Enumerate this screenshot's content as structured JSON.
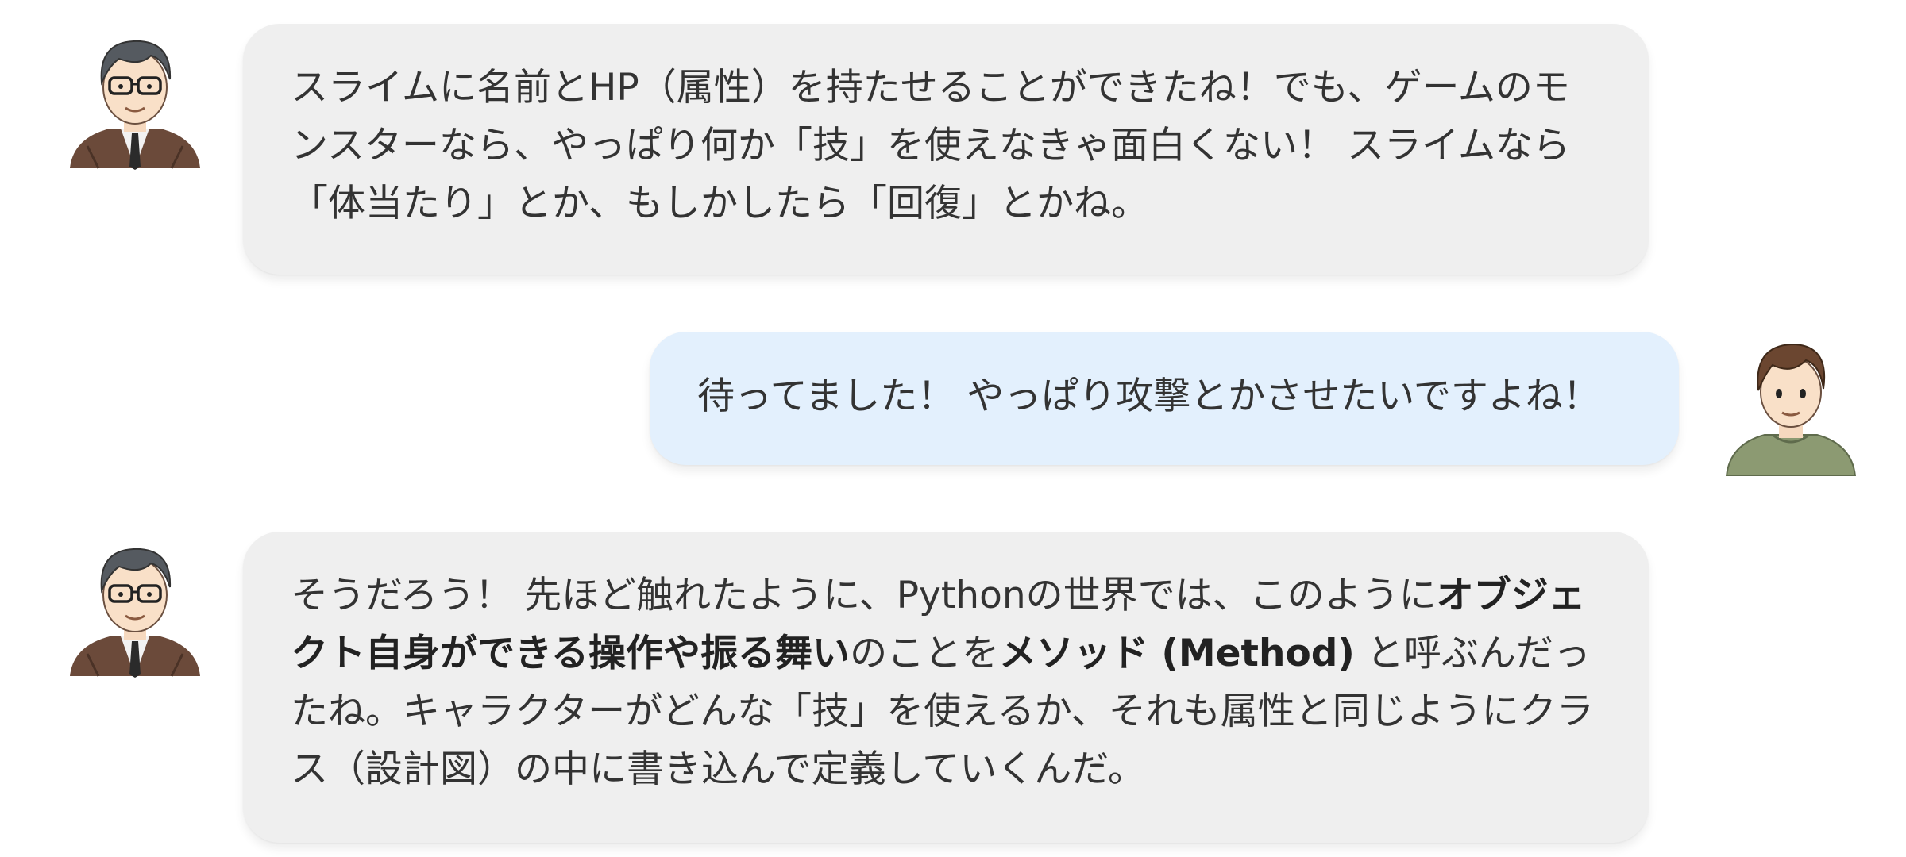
{
  "messages": [
    {
      "speaker": "teacher",
      "avatar_icon": "teacher-avatar-icon",
      "text_parts": [
        {
          "text": "スライムに名前とHP（属性）を持たせることができたね！でも、ゲームのモンスターなら、やっぱり何か「技」を使えなきゃ面白くない！ スライムなら「体当たり」とか、もしかしたら「回復」とかね。",
          "bold": false
        }
      ]
    },
    {
      "speaker": "student",
      "avatar_icon": "student-avatar-icon",
      "text_parts": [
        {
          "text": "待ってました！ やっぱり攻撃とかさせたいですよね！",
          "bold": false
        }
      ]
    },
    {
      "speaker": "teacher",
      "avatar_icon": "teacher-avatar-icon",
      "text_parts": [
        {
          "text": "そうだろう！ 先ほど触れたように、Pythonの世界では、このように",
          "bold": false
        },
        {
          "text": "オブジェクト自身ができる操作や振る舞い",
          "bold": true
        },
        {
          "text": "のことを",
          "bold": false
        },
        {
          "text": "メソッド (Method)",
          "bold": true
        },
        {
          "text": " と呼ぶんだったね。キャラクターがどんな「技」を使えるか、それも属性と同じようにクラス（設計図）の中に書き込んで定義していくんだ。",
          "bold": false
        }
      ]
    }
  ],
  "colors": {
    "teacher_bubble": "#efefef",
    "student_bubble": "#e3f0fd",
    "text": "#333333"
  }
}
